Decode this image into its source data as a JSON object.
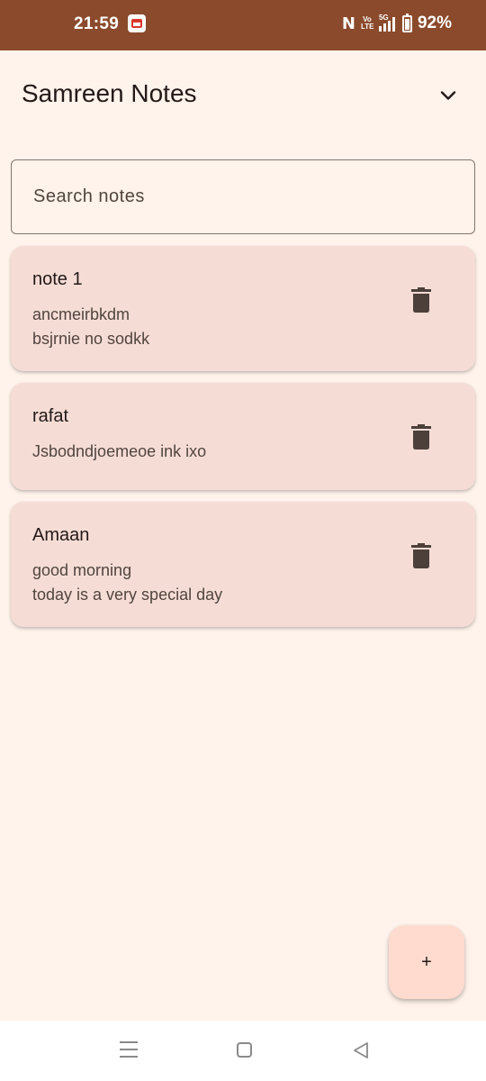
{
  "status_bar": {
    "time": "21:59",
    "battery": "92%",
    "network": "5G",
    "volte": "Vo LTE",
    "nfc_icon": "nfc-icon",
    "app_icon": "app-notification-icon"
  },
  "header": {
    "title": "Samreen Notes",
    "menu_icon": "chevron-down-icon"
  },
  "search": {
    "placeholder": "Search notes",
    "value": ""
  },
  "notes": [
    {
      "title": "note 1",
      "body": "ancmeirbkdm\nbsjrnie no sodkk"
    },
    {
      "title": "rafat",
      "body": "Jsbodndjoemeoe ink ixo"
    },
    {
      "title": "Amaan",
      "body": "good morning\ntoday is a very special day"
    }
  ],
  "fab": {
    "label": "+"
  },
  "colors": {
    "status_bar": "#8b4a2b",
    "background": "#fff3eb",
    "card": "#f5ddd6",
    "fab": "#ffdbcf",
    "icon": "#4d3f3a"
  }
}
